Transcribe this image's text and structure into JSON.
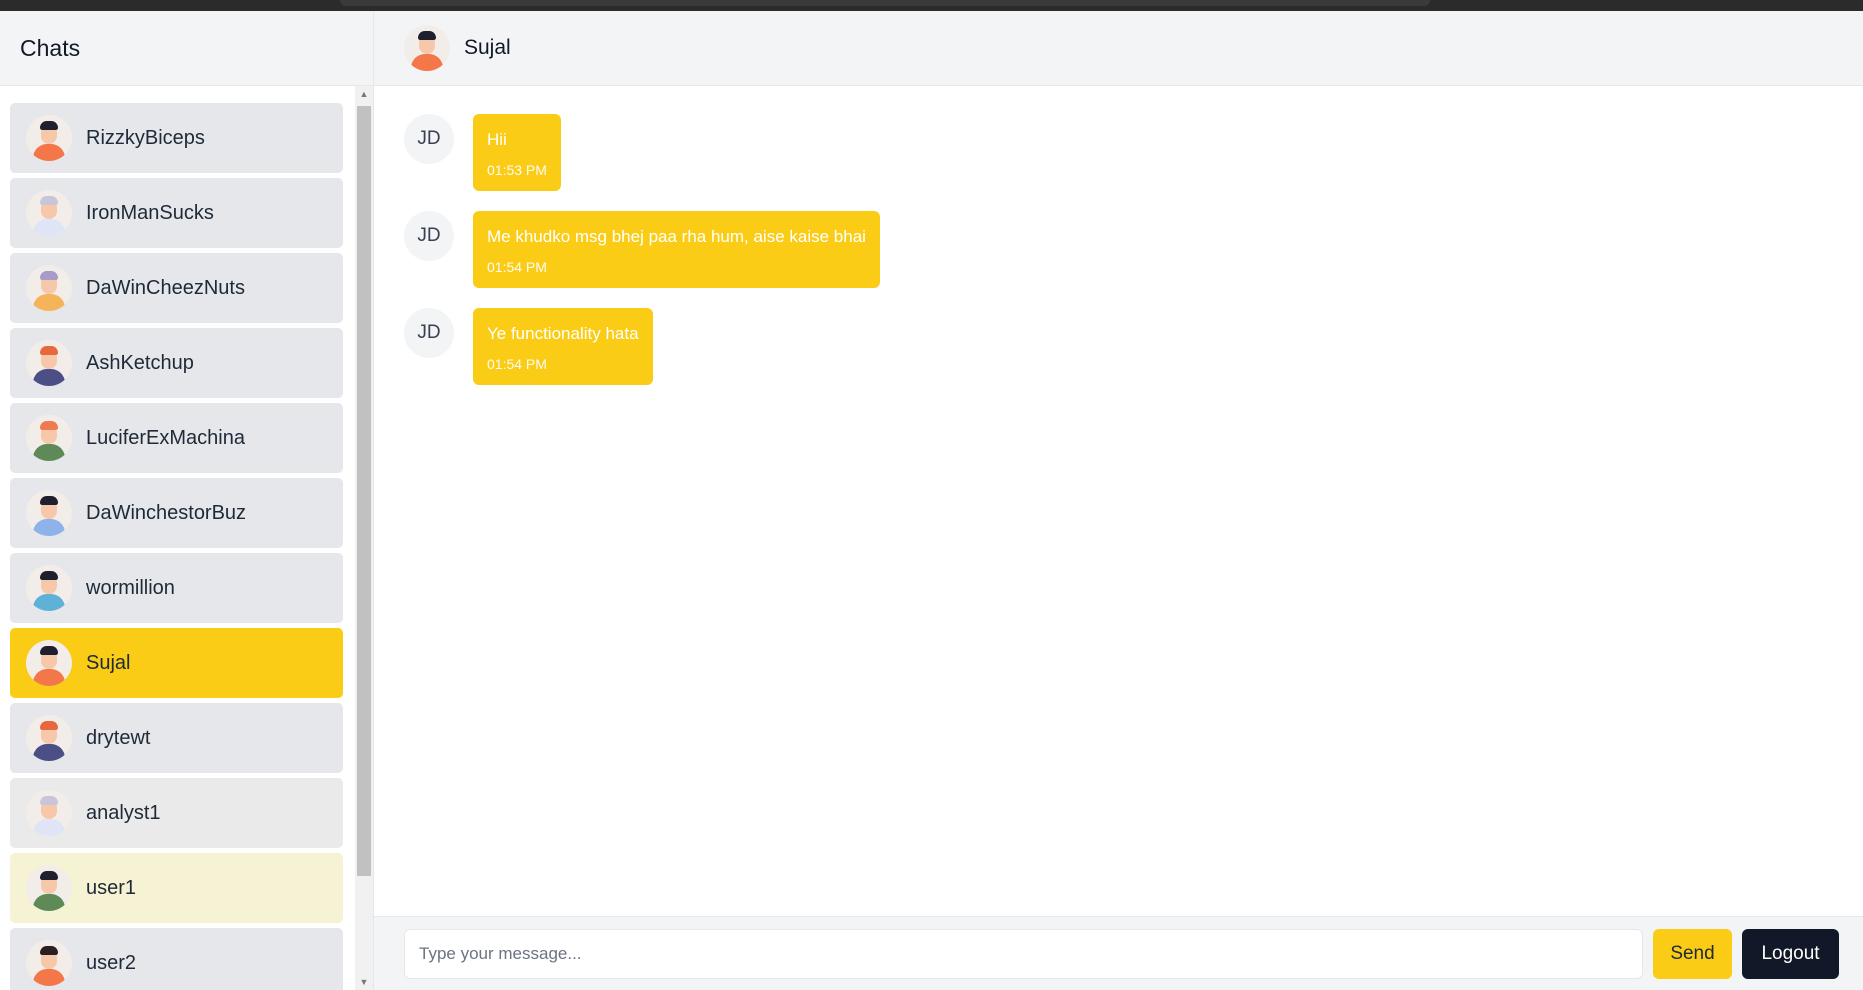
{
  "sidebar": {
    "title": "Chats",
    "chats": [
      {
        "name": "RizzkyBiceps",
        "hair": "#1f1f2e",
        "shirt": "#f4774a"
      },
      {
        "name": "IronManSucks",
        "hair": "#c7c7d9",
        "shirt": "#dfe4f7"
      },
      {
        "name": "DaWinCheezNuts",
        "hair": "#a79cc9",
        "shirt": "#f6b45a"
      },
      {
        "name": "AshKetchup",
        "hair": "#e8683e",
        "shirt": "#4b4f86"
      },
      {
        "name": "LuciferExMachina",
        "hair": "#f07a4f",
        "shirt": "#5e8a58"
      },
      {
        "name": "DaWinchestorBuz",
        "hair": "#1f1f2e",
        "shirt": "#8db3ea"
      },
      {
        "name": "wormillion",
        "hair": "#1f1f2e",
        "shirt": "#5fb1d8"
      },
      {
        "name": "Sujal",
        "hair": "#1f1f2e",
        "shirt": "#f4774a",
        "active": true
      },
      {
        "name": "drytewt",
        "hair": "#e8683e",
        "shirt": "#4b4f86"
      },
      {
        "name": "analyst1",
        "hair": "#c7c7d9",
        "shirt": "#dfe4f7"
      },
      {
        "name": "user1",
        "hair": "#1f1f2e",
        "shirt": "#5e8a58"
      },
      {
        "name": "user2",
        "hair": "#2b1f1f",
        "shirt": "#f4774a"
      }
    ]
  },
  "header": {
    "contact_name": "Sujal"
  },
  "messages": [
    {
      "initials": "JD",
      "text": "Hii",
      "time": "01:53 PM"
    },
    {
      "initials": "JD",
      "text": "Me khudko msg bhej paa rha hum, aise kaise bhai",
      "time": "01:54 PM"
    },
    {
      "initials": "JD",
      "text": "Ye functionality hata",
      "time": "01:54 PM"
    }
  ],
  "composer": {
    "placeholder": "Type your message...",
    "send_label": "Send",
    "logout_label": "Logout"
  },
  "colors": {
    "accent": "#facc15",
    "dark": "#111827",
    "panel": "#f3f4f6"
  }
}
